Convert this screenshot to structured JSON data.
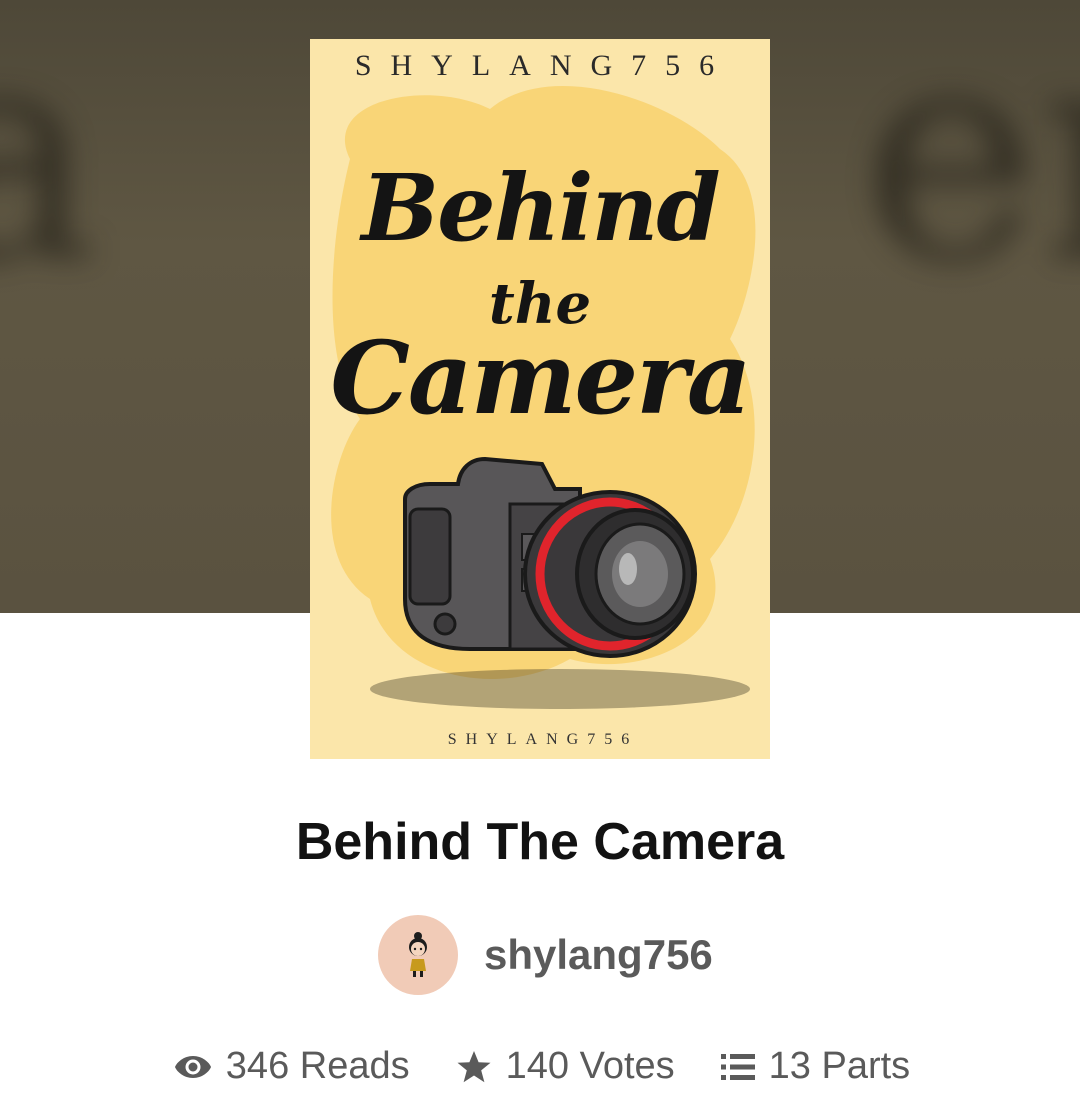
{
  "cover": {
    "author_top": "SHYLANG756",
    "title_line1": "Behind",
    "title_line2": "the",
    "title_line3": "Camera",
    "author_bottom": "SHYLANG756"
  },
  "story": {
    "title": "Behind The Camera"
  },
  "author": {
    "name": "shylang756",
    "avatar_icon": "avatar-icon"
  },
  "stats": {
    "reads_label": "346 Reads",
    "reads_icon": "eye-icon",
    "votes_label": "140 Votes",
    "votes_icon": "star-icon",
    "parts_label": "13 Parts",
    "parts_icon": "list-icon"
  },
  "colors": {
    "cover_bg": "#fbe6aa",
    "hero_bg": "#5f5743",
    "avatar_bg": "#f1cbb7",
    "text_muted": "#5a5a5a",
    "text_dark": "#121212",
    "lens_ring": "#e0242c"
  }
}
